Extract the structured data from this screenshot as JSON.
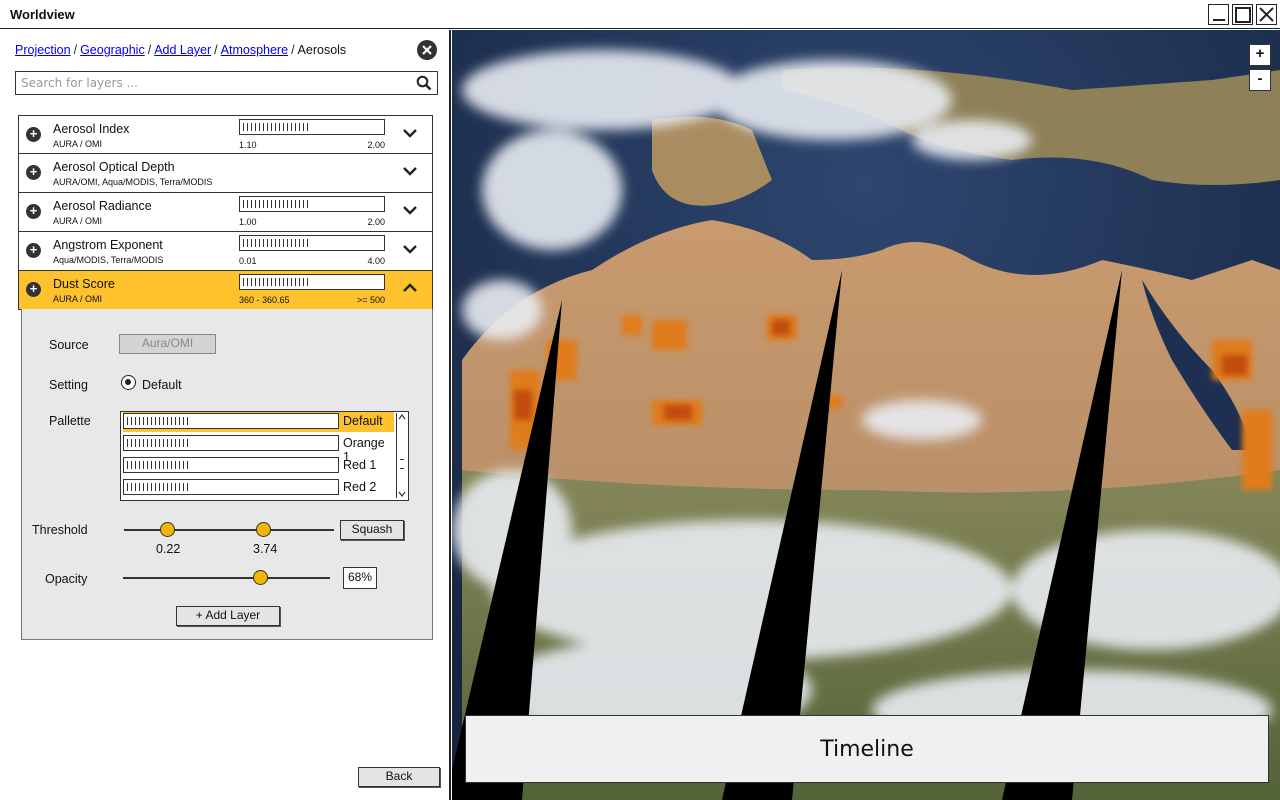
{
  "window": {
    "title": "Worldview"
  },
  "breadcrumb": {
    "items": [
      "Projection",
      "Geographic",
      "Add Layer",
      "Atmosphere"
    ],
    "current": "Aerosols",
    "separator": "/"
  },
  "search": {
    "placeholder": "Search for layers ...",
    "value": ""
  },
  "layers": [
    {
      "name": "Aerosol Index",
      "source": "AURA / OMI",
      "min": "1.10",
      "max": "2.00",
      "expanded": false
    },
    {
      "name": "Aerosol Optical Depth",
      "source": "AURA/OMI, Aqua/MODIS, Terra/MODIS",
      "expanded": false
    },
    {
      "name": "Aerosol Radiance",
      "source": "AURA / OMI",
      "min": "1.00",
      "max": "2.00",
      "expanded": false
    },
    {
      "name": "Angstrom Exponent",
      "source": "Aqua/MODIS, Terra/MODIS",
      "min": "0.01",
      "max": "4.00",
      "expanded": false
    },
    {
      "name": "Dust Score",
      "source": "AURA / OMI",
      "min": "360 - 360.65",
      "max": ">= 500",
      "expanded": true
    }
  ],
  "detail": {
    "source_label": "Source",
    "source_value": "Aura/OMI",
    "setting_label": "Setting",
    "setting_value": "Default",
    "palette_label": "Pallette",
    "palettes": [
      "Default",
      "Orange 1",
      "Red 1",
      "Red 2"
    ],
    "selected_palette": "Default",
    "threshold_label": "Threshold",
    "threshold_low": "0.22",
    "threshold_high": "3.74",
    "squash_label": "Squash",
    "opacity_label": "Opacity",
    "opacity_value": "68%",
    "add_layer_label": "+ Add Layer"
  },
  "footer": {
    "back_label": "Back"
  },
  "map": {
    "zoom_in": "+",
    "zoom_out": "-",
    "timeline_label": "Timeline"
  },
  "colors": {
    "accent": "#fdc22c",
    "knob": "#f2b705",
    "link": "#0000ee"
  }
}
